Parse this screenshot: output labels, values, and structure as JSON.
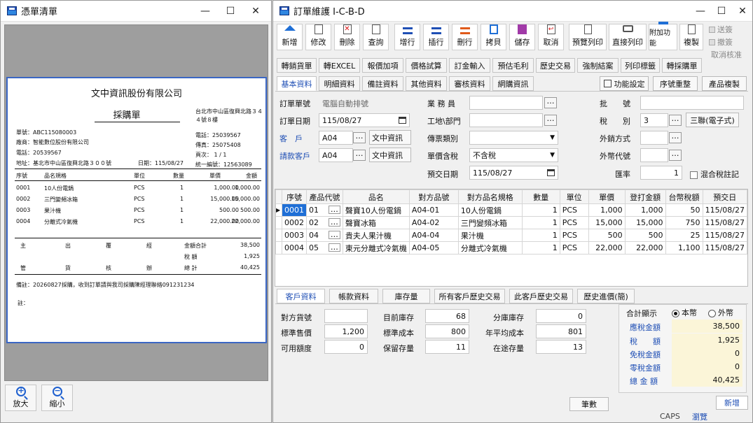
{
  "left_window": {
    "title": "憑單清單",
    "controls": [
      "—",
      "☐",
      "✕"
    ],
    "document": {
      "company": "文中資訊股份有限公司",
      "doc_title": "採購單",
      "address_right": "台北市中山區復興北路３４４號８樓",
      "phone_right": "電話：25039567",
      "fax_right": "傳真：25075408",
      "page_right": "頁次：   1 / 1",
      "tax_id_right": "統一編號：12563089",
      "order_no": "單號：ABC115080003",
      "vendor": "廠商：智能數位股份有限公司",
      "vendor_phone": "電話：20539567",
      "vendor_address": "地址：基北市中山區復興北路３００號",
      "date": "日期：115/08/27",
      "columns": [
        "序號",
        "品名規格",
        "單位",
        "數量",
        "單價",
        "金額"
      ],
      "rows": [
        [
          "0001",
          "10人份電鍋",
          "PCS",
          "1",
          "1,000.00",
          "1,000.00"
        ],
        [
          "0002",
          "三門變頻冰箱",
          "PCS",
          "1",
          "15,000.00",
          "15,000.00"
        ],
        [
          "0003",
          "果汁機",
          "PCS",
          "1",
          "500.00",
          "500.00"
        ],
        [
          "0004",
          "分離式冷氣機",
          "PCS",
          "1",
          "22,000.00",
          "22,000.00"
        ]
      ],
      "sign_a": [
        "主",
        "出",
        "覆",
        "經"
      ],
      "sign_b": [
        "管",
        "貨",
        "核",
        "辦"
      ],
      "subtotal_label": "金額合計",
      "subtotal": "38,500",
      "tax_label": "稅      額",
      "tax": "1,925",
      "total_label": "總      計",
      "total": "40,425",
      "remark": "備註：20260827採購，收到訂單請與我司採購陳經理聯絡091231234",
      "note": "註："
    },
    "zoom_in": "放大",
    "zoom_out": "縮小"
  },
  "right_window": {
    "title": "訂單維護 I-C-B-D",
    "controls": [
      "—",
      "☐",
      "✕"
    ],
    "toolbar": [
      "新增",
      "修改",
      "刪除",
      "查詢",
      "增行",
      "插行",
      "刪行",
      "拷貝",
      "儲存",
      "取消",
      "預覽列印",
      "直接列印",
      "附加功能",
      "複製"
    ],
    "toolbar_right": [
      "送簽",
      "撤簽",
      "取消核准"
    ],
    "function_tabs": [
      "轉銷貨單",
      "轉EXCEL",
      "報價加項",
      "價格試算",
      "訂金輸入",
      "預估毛利",
      "歷史交易",
      "強制結案",
      "列印標籤",
      "轉採購單"
    ],
    "data_tabs": [
      "基本資料",
      "明細資料",
      "備註資料",
      "其他資料",
      "審核資料",
      "網購資訊"
    ],
    "right_buttons": [
      "功能設定",
      "序號重整",
      "產品複製"
    ],
    "form": {
      "order_no_label": "訂單單號",
      "order_no_value": "電腦自動排號",
      "order_date_label": "訂單日期",
      "order_date": "115/08/27",
      "customer_label": "客　戶",
      "customer_code": "A04",
      "customer_name": "文中資訊",
      "bill_customer_label": "請款客戶",
      "bill_customer_code": "A04",
      "bill_customer_name": "文中資訊",
      "sales_label": "業 務 員",
      "site_label": "工地\\部門",
      "voucher_type_label": "傳票類別",
      "price_tax_label": "單價含稅",
      "price_tax_value": "不含稅",
      "delivery_label": "預交日期",
      "delivery_date": "115/08/27",
      "batch_label": "批　　號",
      "tax_type_label": "稅　　別",
      "tax_type_code": "3",
      "tax_type_name": "三聯(電子式)",
      "export_label": "外銷方式",
      "currency_label": "外幣代號",
      "rate_label": "匯率",
      "rate_value": "1",
      "mixed_tax_label": "混合稅註記"
    },
    "grid": {
      "columns": [
        "序號",
        "產品代號",
        "品名",
        "對方品號",
        "對方品名規格",
        "數量",
        "單位",
        "單價",
        "登打金額",
        "台幣稅額",
        "預交日"
      ],
      "rows": [
        [
          "0001",
          "01",
          "聲寶10人份電鍋",
          "A04-01",
          "10人份電鍋",
          "1",
          "PCS",
          "1,000",
          "1,000",
          "50",
          "115/08/27"
        ],
        [
          "0002",
          "02",
          "聲寶冰箱",
          "A04-02",
          "三門變頻冰箱",
          "1",
          "PCS",
          "15,000",
          "15,000",
          "750",
          "115/08/27"
        ],
        [
          "0003",
          "04",
          "貴夫人果汁機",
          "A04-04",
          "果汁機",
          "1",
          "PCS",
          "500",
          "500",
          "25",
          "115/08/27"
        ],
        [
          "0004",
          "05",
          "東元分離式冷氣機",
          "A04-05",
          "分離式冷氣機",
          "1",
          "PCS",
          "22,000",
          "22,000",
          "1,100",
          "115/08/27"
        ]
      ]
    },
    "bottom_tabs": [
      "客戶資料",
      "帳款資料",
      "庫存量",
      "所有客戶歷史交易",
      "此客戶歷史交易",
      "歷史進價(簡)"
    ],
    "stock": {
      "party_no_label": "對方貨號",
      "party_no": "",
      "std_price_label": "標準售價",
      "std_price": "1,200",
      "credit_label": "可用額度",
      "credit": "0",
      "current_stock_label": "目前庫存",
      "current_stock": "68",
      "std_cost_label": "標準成本",
      "std_cost": "800",
      "reserved_label": "保留存量",
      "reserved": "11",
      "branch_stock_label": "分庫庫存",
      "branch_stock": "0",
      "avg_cost_label": "年平均成本",
      "avg_cost": "801",
      "transit_label": "在途存量",
      "transit": "13"
    },
    "summary": {
      "title": "合計顯示",
      "local_label": "本幣",
      "foreign_label": "外幣",
      "rows": [
        {
          "label": "應稅金額",
          "value": "38,500"
        },
        {
          "label": "稅　　額",
          "value": "1,925"
        },
        {
          "label": "免稅金額",
          "value": "0"
        },
        {
          "label": "零稅金額",
          "value": "0"
        },
        {
          "label": "總 金 額",
          "value": "40,425"
        }
      ]
    },
    "count_button": "筆數",
    "status_caps": "CAPS",
    "status_mode": "瀏覽",
    "mode_button": "新增"
  }
}
